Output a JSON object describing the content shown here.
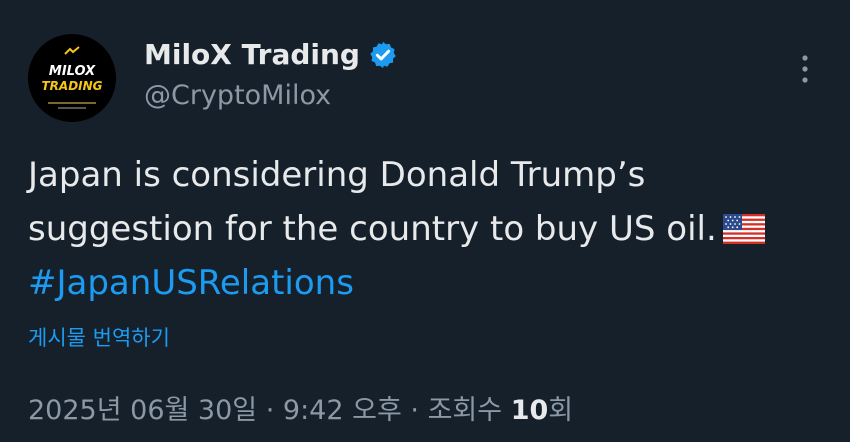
{
  "author": {
    "name": "MiloX Trading",
    "handle": "@CryptoMilox",
    "avatar_text_line1": "MILOX",
    "avatar_text_line2": "TRADING",
    "verified_icon": "verified-badge-icon",
    "verified_color": "#1d9bf0"
  },
  "tweet": {
    "line1": "Japan is considering Donald Trump’s",
    "line2": "suggestion for the country to buy US oil.",
    "flag_icon": "us-flag-icon",
    "hashtag": "#JapanUSRelations"
  },
  "translate_label": "게시물 번역하기",
  "meta": {
    "date": "2025년 06월 30일",
    "separator": "·",
    "time": "9:42 오후",
    "views_label": "조회수",
    "views_count": "10",
    "views_unit": "회"
  },
  "colors": {
    "background": "#15202b",
    "primary_text": "#e7e9ea",
    "secondary_text": "#8b98a5",
    "accent": "#1d9bf0"
  }
}
